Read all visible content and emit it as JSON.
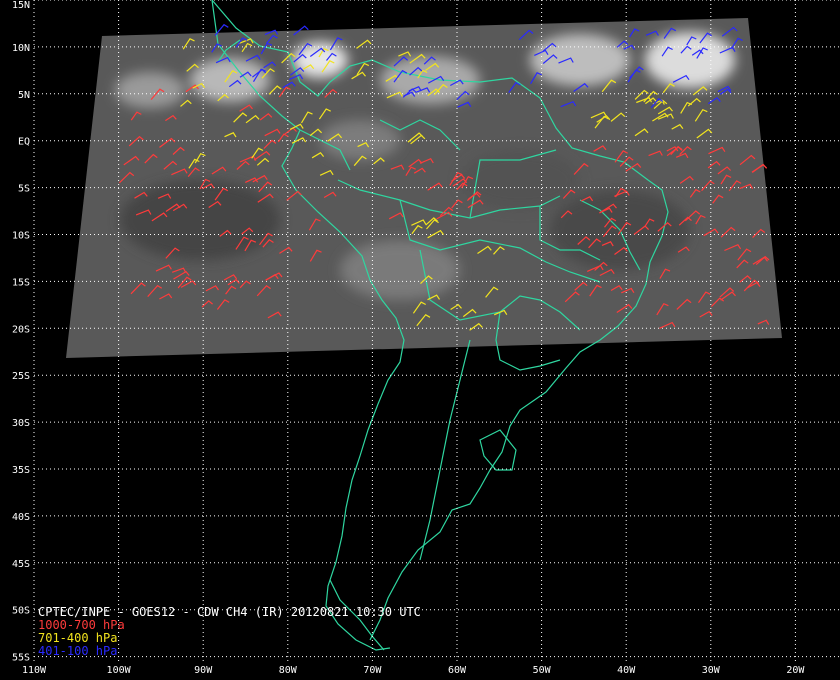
{
  "title": "CPTEC/INPE - GOES12 - CDW CH4 (IR) 20120821 10:30 UTC",
  "legend": [
    {
      "label": "1000-700 hPa",
      "color": "#ff3b3b"
    },
    {
      "label": "701-400 hPa",
      "color": "#f2e41e"
    },
    {
      "label": "401-100 hPa",
      "color": "#2a2aff"
    }
  ],
  "colors": {
    "background": "#000000",
    "coast": "#2fd6a0",
    "grid": "#ffffff",
    "imagery": "#5a5a5a"
  },
  "lat_labels": [
    "15N",
    "10N",
    "5N",
    "EQ",
    "5S",
    "10S",
    "15S",
    "20S",
    "25S",
    "30S",
    "35S",
    "40S",
    "45S",
    "50S",
    "55S"
  ],
  "lon_labels": [
    "110W",
    "100W",
    "90W",
    "80W",
    "70W",
    "60W",
    "50W",
    "40W",
    "30W",
    "20W"
  ]
}
